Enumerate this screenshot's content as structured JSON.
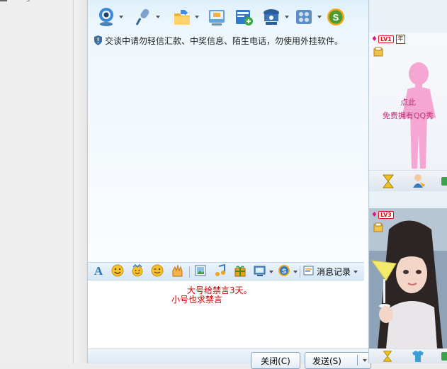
{
  "left_pane": {
    "mark": "ng"
  },
  "notice": {
    "text": "交谈中请勿轻信汇款、中奖信息、陌生电话，勿使用外挂软件。"
  },
  "toolbar": {
    "icons": [
      "webcam-icon",
      "microphone-icon",
      "send-file-icon",
      "remote-assist-icon",
      "app-add-icon",
      "settings-icon",
      "qq-show-icon",
      "soso-icon"
    ]
  },
  "input_toolbar": {
    "history_label": "消息记录"
  },
  "input": {
    "lines": [
      "大号给禁言3天。",
      "小号也求禁言"
    ]
  },
  "buttons": {
    "close_label": "关闭(C)",
    "send_label": "发送(S)"
  },
  "show_panel": {
    "top": {
      "level": "LV1",
      "year": "年",
      "promo_line1": "点此",
      "promo_line2": "免费拥有QQ秀"
    },
    "bottom": {
      "level": "LV3"
    }
  },
  "colors": {
    "message_text": "#cc0000",
    "promo_text": "#c0307a",
    "accent": "#2a74c2"
  }
}
